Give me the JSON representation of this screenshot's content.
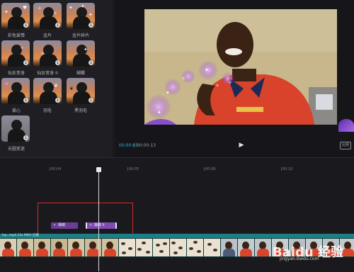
{
  "effects": {
    "items": [
      {
        "label": "彩色爱情"
      },
      {
        "label": "金片"
      },
      {
        "label": "金片碎片"
      },
      {
        "label": "仙女变身"
      },
      {
        "label": "仙女变身 II"
      },
      {
        "label": "蝴蝶"
      },
      {
        "label": "爱心"
      },
      {
        "label": "羽毛"
      },
      {
        "label": "黑羽毛"
      },
      {
        "label": "光圈变迷"
      }
    ]
  },
  "player": {
    "time_current": "00:00:03",
    "time_total": "00:00:13",
    "play_icon": "▶",
    "ratio_label": "比例"
  },
  "timeline": {
    "ruler": [
      "00:04",
      "00:05",
      "00:08",
      "00:10"
    ],
    "clips": [
      {
        "label": "蝴蝶",
        "icon": "magic-icon"
      },
      {
        "label": "蝴蝶 II",
        "icon": "magic-icon"
      }
    ],
    "track_label": "hq...mp4  12s  MOV  已裁"
  },
  "watermark": {
    "text": "Baidu 经验",
    "sub": "jingyan.baidu.com"
  },
  "colors": {
    "accent": "#2bb5c8",
    "effect_clip": "#6b3e96",
    "highlight": "#d62b2b",
    "track": "#1c7f86"
  }
}
